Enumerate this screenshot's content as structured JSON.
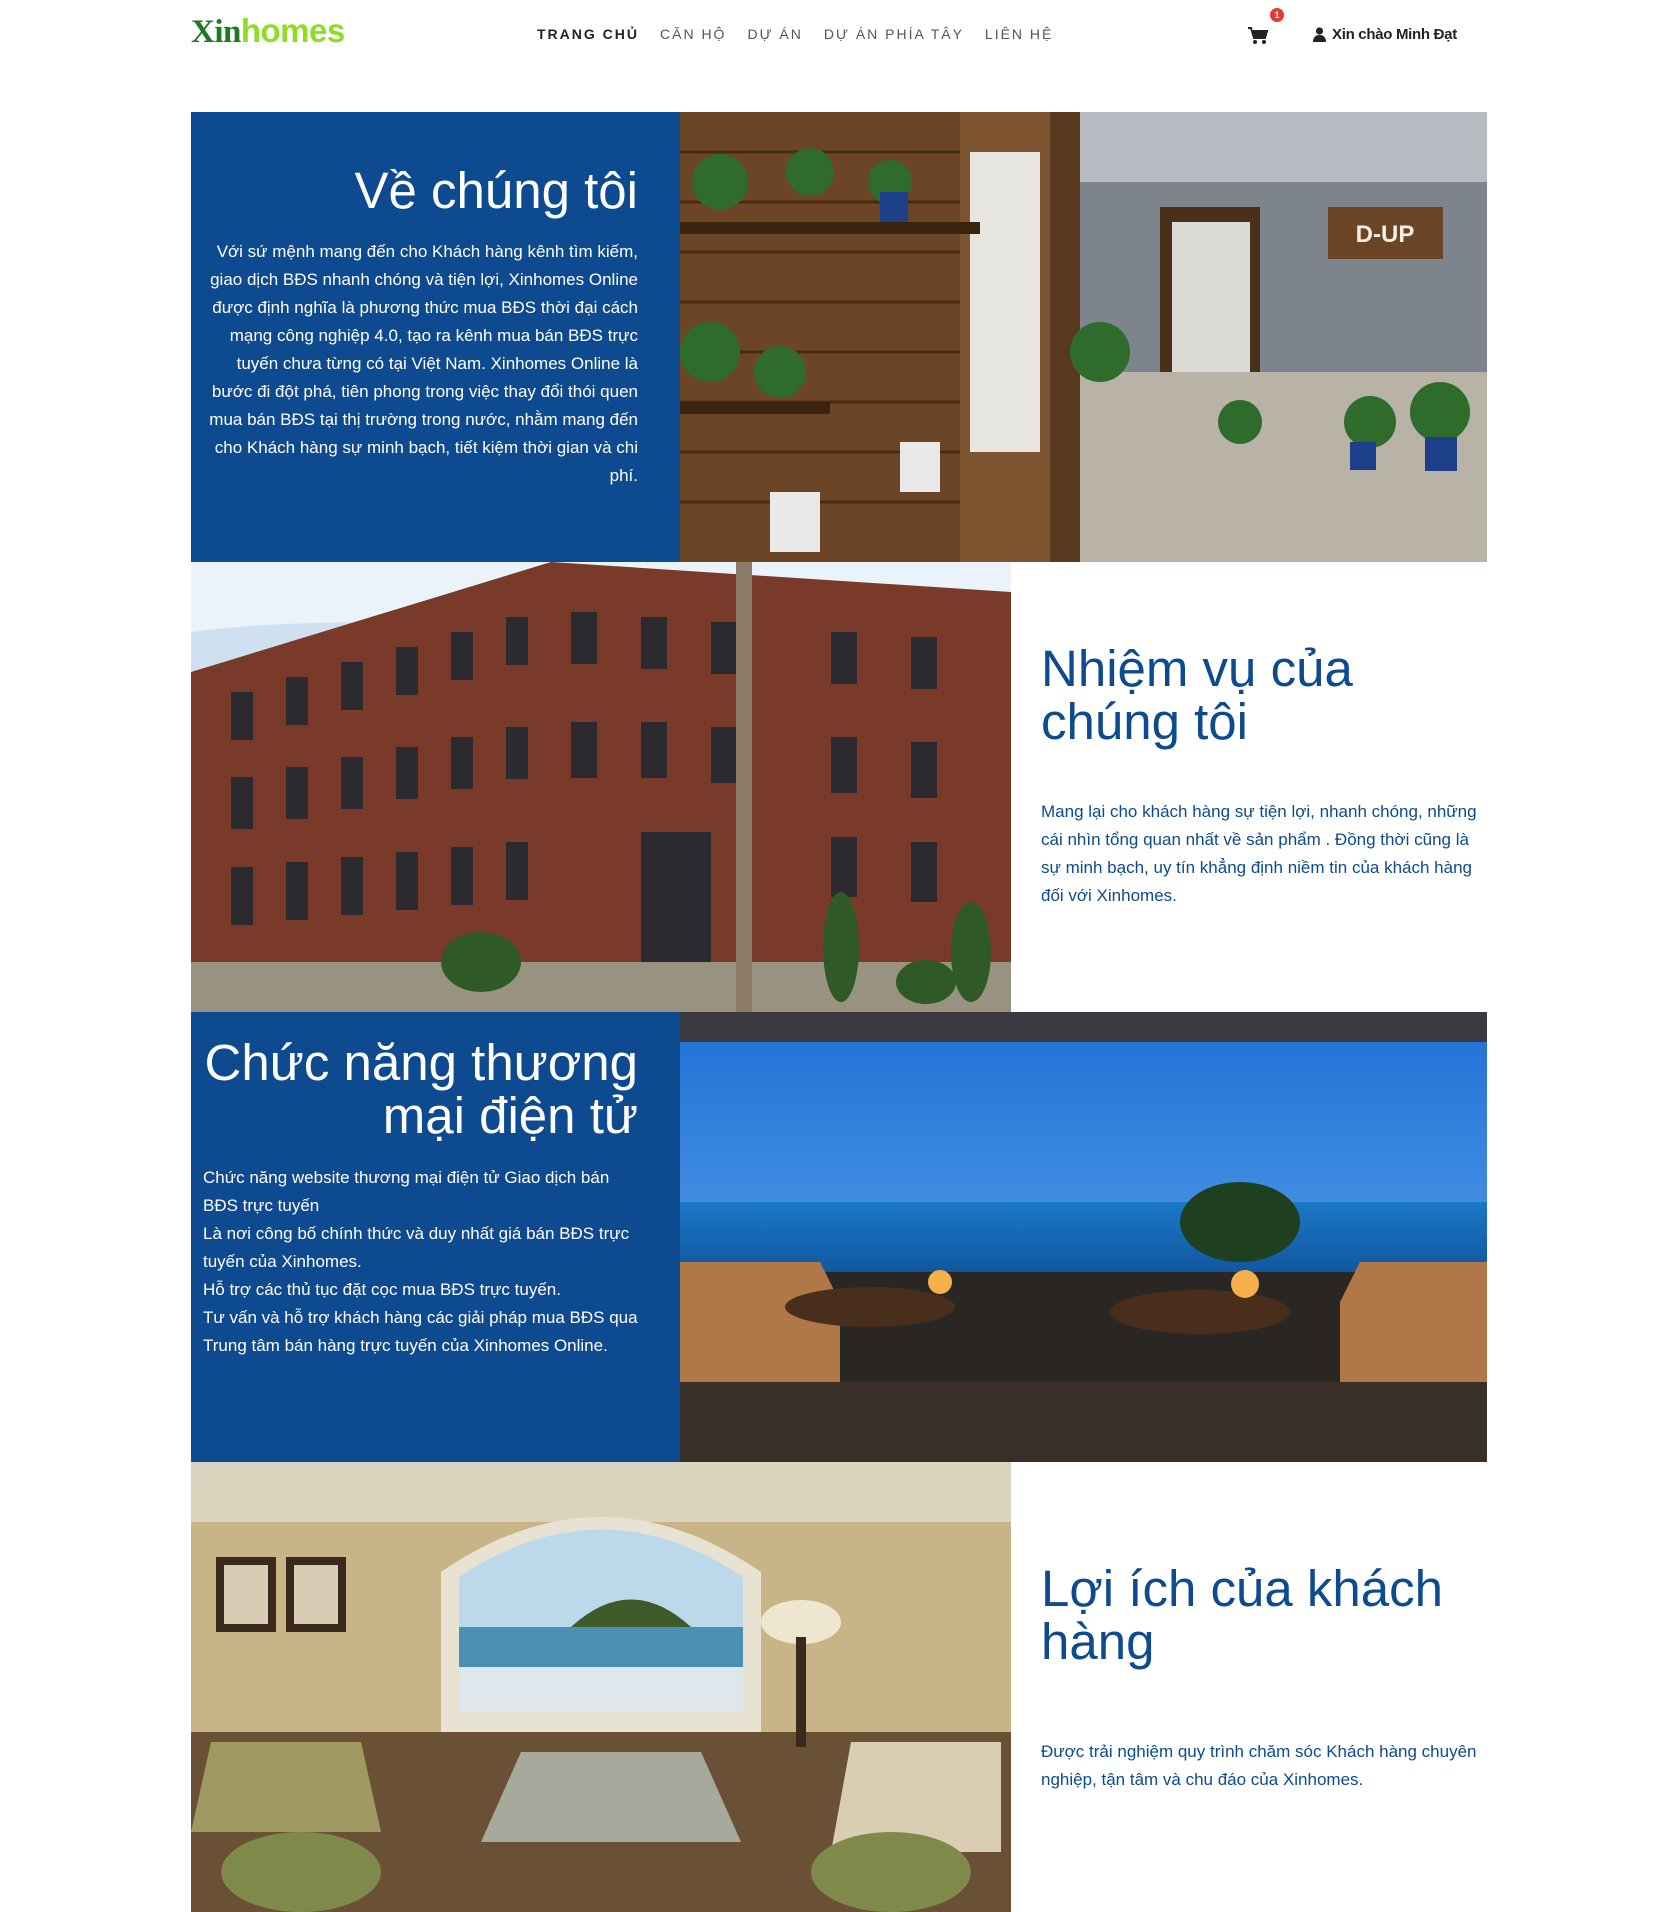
{
  "header": {
    "logo_part1": "Xin",
    "logo_part2": "homes",
    "nav": [
      "TRANG CHỦ",
      "CĂN HỘ",
      "DỰ ÁN",
      "DỰ ÁN PHÍA TÂY",
      "LIÊN HỆ"
    ],
    "cart_count": "1",
    "greeting": "Xin chào Minh Đạt"
  },
  "colors": {
    "primary_blue": "#0d4a8f",
    "logo_green": "#1f7a1f",
    "logo_lime": "#8ddd25",
    "badge_red": "#e53935"
  },
  "about": {
    "title": "Về chúng tôi",
    "body": "Với sứ mệnh mang đến cho Khách hàng kênh tìm kiếm, giao dịch BĐS nhanh chóng và tiện lợi, Xinhomes Online được định nghĩa là phương thức mua BĐS thời đại cách mạng công nghiệp 4.0, tạo ra kênh mua bán BĐS trực tuyến chưa từng có tại Việt Nam. Xinhomes Online là bước đi đột phá, tiên phong trong việc thay đổi thói quen mua bán BĐS tại thị trường trong nước, nhằm mang đến cho Khách hàng sự minh bạch, tiết kiệm thời gian và chi phí.",
    "sign_text": "D-UP"
  },
  "mission": {
    "title": "Nhiệm vụ của chúng tôi",
    "body": "Mang lại cho khách hàng sự tiện lợi, nhanh chóng, những cái nhìn tổng quan nhất về sản phẩm . Đồng thời cũng là sự minh bạch, uy tín khẳng định niềm tin của khách hàng đối với Xinhomes."
  },
  "ecommerce": {
    "title": "Chức năng thương mại điện tử",
    "lines": [
      "Chức năng website thương mại điện tử Giao dịch bán BĐS trực tuyến",
      "Là nơi công bố chính thức và duy nhất giá bán BĐS trực tuyến của Xinhomes.",
      "Hỗ trợ các thủ tục đặt cọc mua BĐS trực tuyến.",
      "Tư vấn và hỗ trợ khách hàng các giải pháp mua BĐS qua Trung tâm bán hàng trực tuyến của Xinhomes Online."
    ]
  },
  "benefits": {
    "title": "Lợi ích của khách hàng",
    "body": "Được trải nghiệm quy trình chăm sóc Khách hàng chuyên nghiệp, tận tâm và chu đáo của Xinhomes."
  },
  "icons": [
    "cart-icon",
    "user-icon"
  ]
}
